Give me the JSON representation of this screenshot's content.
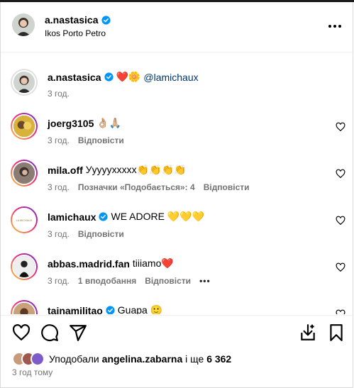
{
  "post": {
    "username": "a.nastasica",
    "location": "Ikos Porto Petro",
    "more_icon": "more-horizontal-icon"
  },
  "caption": {
    "username": "a.nastasica",
    "emojis": "❤️🌼",
    "mention": "@lamichaux",
    "time": "3 год."
  },
  "comments": [
    {
      "username": "joerg3105",
      "text": "👌🏼🙏🏼",
      "time": "3 год.",
      "likes_label": "",
      "reply": "Відповісти",
      "verified": false,
      "extra": ""
    },
    {
      "username": "mila.off",
      "text": "Уууууххххх👏👏👏👏",
      "time": "3 год.",
      "likes_label": "Позначки «Подобається»: 4",
      "reply": "Відповісти",
      "verified": false,
      "extra": ""
    },
    {
      "username": "lamichaux",
      "text": "WE ADORE 💛💛💛",
      "time": "3 год.",
      "likes_label": "",
      "reply": "Відповісти",
      "verified": true,
      "extra": ""
    },
    {
      "username": "abbas.madrid.fan",
      "text": "tiiiamo❤️",
      "time": "3 год.",
      "likes_label": "1 вподобання",
      "reply": "Відповісти",
      "verified": false,
      "extra": "•••"
    },
    {
      "username": "tainamilitao",
      "text": "Guapa 🙂",
      "time": "",
      "likes_label": "",
      "reply": "",
      "verified": true,
      "extra": ""
    }
  ],
  "actions": {
    "like": "heart-icon",
    "comment": "comment-icon",
    "share": "share-icon",
    "save_collection": "save-to-collection-icon",
    "bookmark": "bookmark-icon"
  },
  "likes": {
    "prefix": "Уподобали",
    "user": "angelina.zabarna",
    "middle": "і ще",
    "count": "6 362"
  },
  "timestamp": "3 год тому",
  "colors": {
    "verified": "#0095f6",
    "link": "#00376b",
    "muted": "#737373",
    "border": "#dbdbdb"
  }
}
